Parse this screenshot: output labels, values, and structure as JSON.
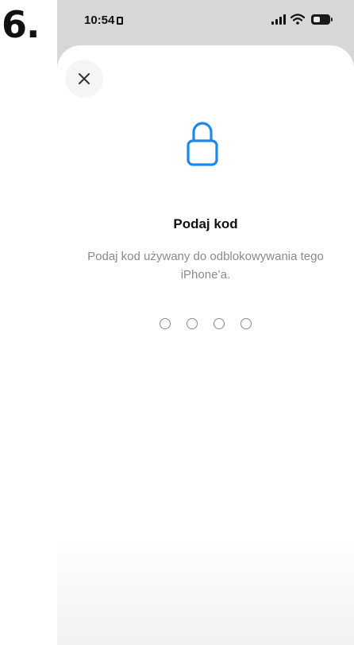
{
  "step_label": "6.",
  "status_bar": {
    "time": "10:54",
    "icons": [
      "signal-icon",
      "wifi-icon",
      "battery-icon"
    ]
  },
  "passcode_sheet": {
    "close_icon": "close-icon",
    "lock_icon": "lock-icon",
    "title": "Podaj kod",
    "subtitle": "Podaj kod używany do odblokowywania tego iPhone’a.",
    "passcode_length": 4,
    "entered_digits": 0
  },
  "colors": {
    "accent": "#1e88ea",
    "sheet_background": "#ffffff",
    "backdrop": "#d7d7d9"
  }
}
